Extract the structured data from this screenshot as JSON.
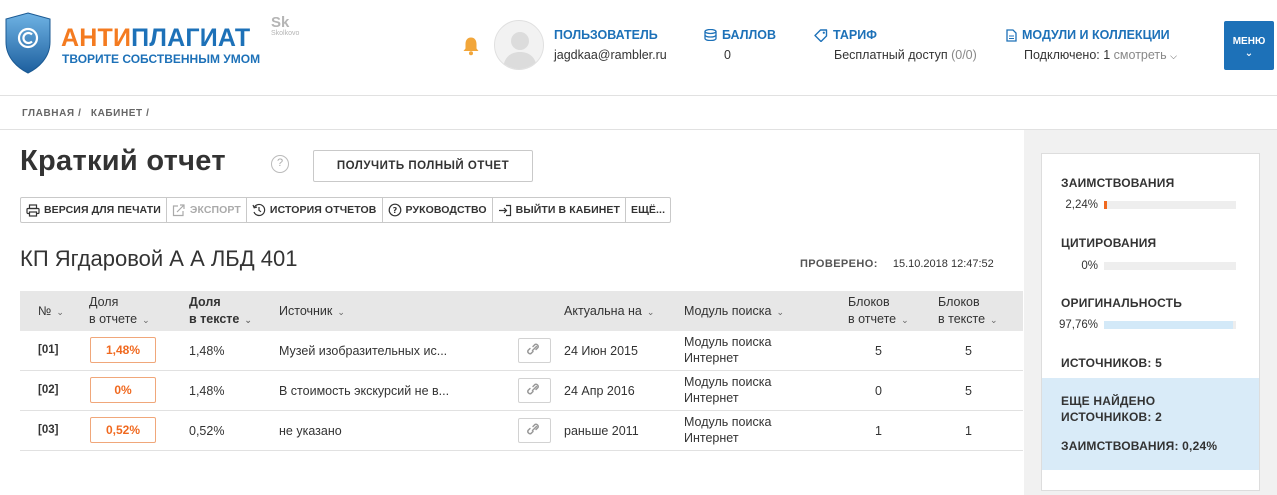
{
  "header": {
    "logo": {
      "part1": "АНТИ",
      "part2": "ПЛАГИАТ",
      "tagline": "ТВОРИТЕ СОБСТВЕННЫМ УМОМ"
    },
    "partner_logo": {
      "main": "Sk",
      "sub": "Skolkovo"
    },
    "user": {
      "label": "ПОЛЬЗОВАТЕЛЬ",
      "email": "jagdkaa@rambler.ru"
    },
    "points": {
      "label": "БАЛЛОВ",
      "value": "0"
    },
    "tariff": {
      "label": "ТАРИФ",
      "value": "Бесплатный доступ",
      "extra": "(0/0)"
    },
    "modules": {
      "label": "МОДУЛИ И КОЛЛЕКЦИИ",
      "value": "Подключено: 1",
      "link": "смотреть"
    },
    "menu_label": "МЕНЮ",
    "colors": {
      "brand_blue": "#1d71b8",
      "brand_orange": "#f47b20"
    }
  },
  "breadcrumb": [
    "ГЛАВНАЯ /",
    "КАБИНЕТ /"
  ],
  "page": {
    "title": "Краткий отчет",
    "full_report_button": "ПОЛУЧИТЬ ПОЛНЫЙ ОТЧЕТ"
  },
  "toolbar": {
    "print": "ВЕРСИЯ ДЛЯ ПЕЧАТИ",
    "export": "ЭКСПОРТ",
    "history": "ИСТОРИЯ ОТЧЕТОВ",
    "guide": "РУКОВОДСТВО",
    "exit": "ВЫЙТИ В КАБИНЕТ",
    "more": "ЕЩЁ..."
  },
  "document": {
    "title": "КП Ягдаровой А А ЛБД 401",
    "checked_label": "ПРОВЕРЕНО:",
    "checked_value": "15.10.2018 12:47:52"
  },
  "table": {
    "headers": {
      "num": "№",
      "share_report_1": "Доля",
      "share_report_2": "в отчете",
      "share_text_1": "Доля",
      "share_text_2": "в тексте",
      "source": "Источник",
      "actual": "Актуальна на",
      "module": "Модуль поиска",
      "blocks_report_1": "Блоков",
      "blocks_report_2": "в отчете",
      "blocks_text_1": "Блоков",
      "blocks_text_2": "в тексте"
    },
    "rows": [
      {
        "num": "[01]",
        "share_report": "1,48%",
        "share_text": "1,48%",
        "source": "Музей изобразительных ис...",
        "date": "24 Июн 2015",
        "module_1": "Модуль поиска",
        "module_2": "Интернет",
        "blocks_report": "5",
        "blocks_text": "5"
      },
      {
        "num": "[02]",
        "share_report": "0%",
        "share_text": "1,48%",
        "source": "В стоимость экскурсий не в...",
        "date": "24 Апр 2016",
        "module_1": "Модуль поиска",
        "module_2": "Интернет",
        "blocks_report": "0",
        "blocks_text": "5"
      },
      {
        "num": "[03]",
        "share_report": "0,52%",
        "share_text": "0,52%",
        "source": "не указано",
        "date": "раньше 2011",
        "module_1": "Модуль поиска",
        "module_2": "Интернет",
        "blocks_report": "1",
        "blocks_text": "1"
      }
    ]
  },
  "stats": {
    "borrowings": {
      "label": "ЗАИМСТВОВАНИЯ",
      "value": "2,24%",
      "fraction": 0.0224,
      "color": "#f0691f"
    },
    "citations": {
      "label": "ЦИТИРОВАНИЯ",
      "value": "0%",
      "fraction": 0.0,
      "color": "#3fa34d"
    },
    "originality": {
      "label": "ОРИГИНАЛЬНОСТЬ",
      "value": "97,76%",
      "fraction": 0.9776,
      "color": "#d3e9f8"
    },
    "sources": "ИСТОЧНИКОВ: 5",
    "found_line1": "ЕЩЕ НАЙДЕНО",
    "found_line2": "ИСТОЧНИКОВ: 2",
    "found_borrowings": "ЗАИМСТВОВАНИЯ: 0,24%"
  }
}
